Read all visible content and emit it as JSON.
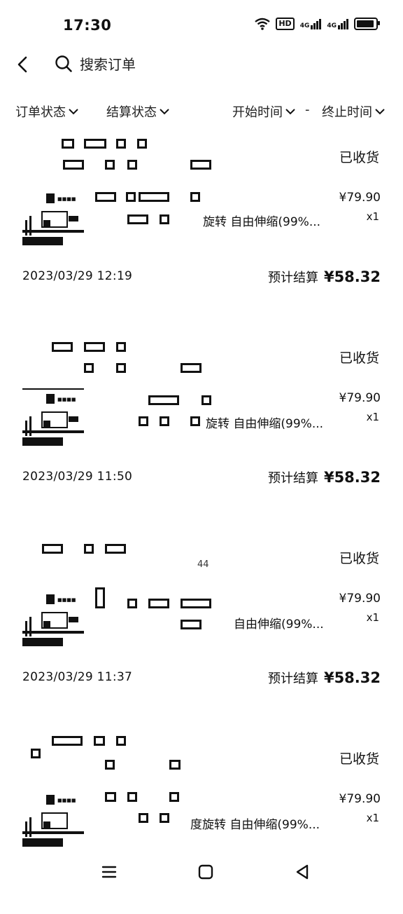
{
  "status_bar": {
    "time": "17:30",
    "hd_label": "HD",
    "network_1": "4G",
    "network_2": "4G"
  },
  "header": {
    "search_label": "搜索订单"
  },
  "filters": {
    "order_status": "订单状态",
    "settle_status": "结算状态",
    "start_time": "开始时间",
    "dash": "-",
    "end_time": "终止时间"
  },
  "orders": [
    {
      "status": "已收货",
      "price": "¥79.90",
      "qty": "x1",
      "name_fragment": "旋转 自由伸缩(99%...",
      "date": "2023/03/29 12:19",
      "settle_label": "预计结算",
      "settle_amount": "¥58.32"
    },
    {
      "status": "已收货",
      "price": "¥79.90",
      "qty": "x1",
      "name_fragment": "旋转 自由伸缩(99%...",
      "date": "2023/03/29 11:50",
      "settle_label": "预计结算",
      "settle_amount": "¥58.32"
    },
    {
      "status": "已收货",
      "price": "¥79.90",
      "qty": "x1",
      "name_fragment": "自由伸缩(99%...",
      "date": "2023/03/29 11:37",
      "settle_label": "预计结算",
      "settle_amount": "¥58.32",
      "fragment": "44"
    },
    {
      "status": "已收货",
      "price": "¥79.90",
      "qty": "x1",
      "name_fragment": "度旋转 自由伸缩(99%..."
    }
  ],
  "icons": {
    "back": "back-arrow-icon",
    "search": "search-icon",
    "chevron": "chevron-down-icon",
    "menu": "menu-icon",
    "home": "home-icon",
    "nav_back": "nav-back-icon"
  }
}
